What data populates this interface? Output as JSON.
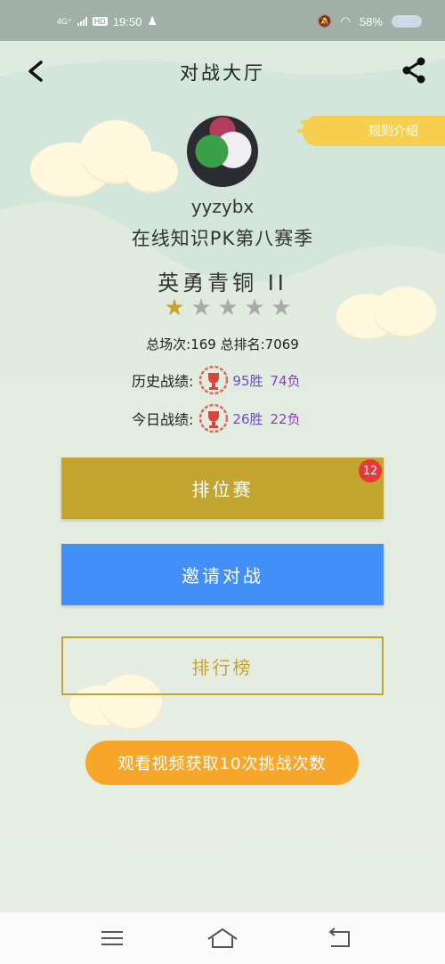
{
  "status_bar": {
    "network": "4G⁺",
    "hd": "HD",
    "time": "19:50",
    "battery": "58%"
  },
  "header": {
    "title": "对战大厅"
  },
  "rules_button": {
    "label": "规则介绍"
  },
  "profile": {
    "username": "yyzybx",
    "season": "在线知识PK第八赛季",
    "rank_title": "英勇青铜 II",
    "stars_filled": 1,
    "stars_total": 5
  },
  "stats": {
    "summary": "总场次:169   总排名:7069",
    "history_label": "历史战绩:",
    "history_wins": "95胜",
    "history_losses": "74负",
    "today_label": "今日战绩:",
    "today_wins": "26胜",
    "today_losses": "22负"
  },
  "buttons": {
    "ranked_label": "排位赛",
    "ranked_badge": "12",
    "invite_label": "邀请对战",
    "leaderboard_label": "排行榜",
    "video_label": "观看视频获取10次挑战次数"
  },
  "colors": {
    "accent_gold": "#c4a431",
    "accent_blue": "#438ff8",
    "accent_orange": "#f6a729",
    "badge_red": "#e63a3a"
  }
}
